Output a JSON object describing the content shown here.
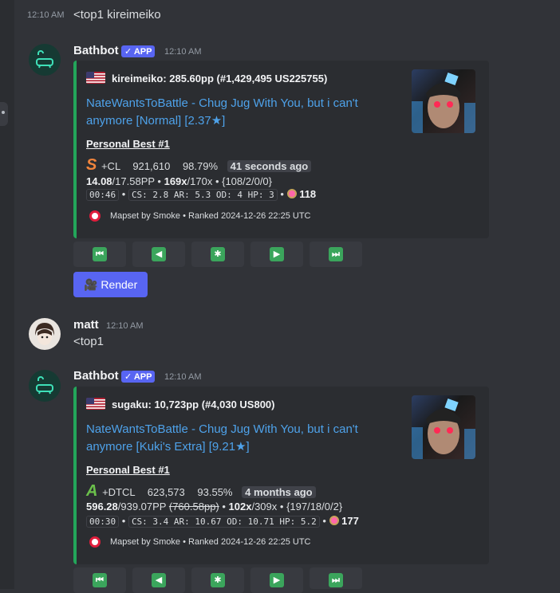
{
  "top_message": {
    "timestamp": "12:10 AM",
    "text": "<top1 kireimeiko"
  },
  "messages": [
    {
      "author": "Bathbot",
      "badge": "✓ APP",
      "timestamp": "12:10 AM",
      "embed": {
        "author_line": "kireimeiko: 285.60pp (#1,429,495 US225755)",
        "title_line1": "NateWantsToBattle - Chug Jug With You, but i can't",
        "title_line2": "anymore [Normal] [2.37★]",
        "pb": "Personal Best #1",
        "grade": "S",
        "grade_color": "#f0843c",
        "mods": "+CL",
        "score": "921,610",
        "acc": "98.79%",
        "ago": "41 seconds ago",
        "pp_bold": "14.08",
        "pp_rest": "/17.58PP",
        "pp_strike": "",
        "combo_bold": "169x",
        "combo_rest": "/170x",
        "hits": "{108/2/0/0}",
        "length": "00:46",
        "stats": "CS: 2.8 AR: 5.3 OD: 4 HP: 3",
        "bpm": "118",
        "footer": "Mapset by Smoke • Ranked 2024-12-26 22:25 UTC"
      }
    },
    {
      "author": "matt",
      "timestamp": "12:10 AM",
      "text": "<top1"
    },
    {
      "author": "Bathbot",
      "badge": "✓ APP",
      "timestamp": "12:10 AM",
      "embed": {
        "author_line": "sugaku: 10,723pp (#4,030 US800)",
        "title_line1": "NateWantsToBattle - Chug Jug With You, but i can't",
        "title_line2": "anymore [Kuki's Extra] [9.21★]",
        "pb": "Personal Best #1",
        "grade": "A",
        "grade_color": "#6bc04b",
        "mods": "+DTCL",
        "score": "623,573",
        "acc": "93.55%",
        "ago": "4 months ago",
        "pp_bold": "596.28",
        "pp_rest": "/939.07PP",
        "pp_strike": "(760.58pp)",
        "combo_bold": "102x",
        "combo_rest": "/309x",
        "hits": "{197/18/0/2}",
        "length": "00:30",
        "stats": "CS: 3.4 AR: 10.67 OD: 10.71 HP: 5.2",
        "bpm": "177",
        "footer": "Mapset by Smoke • Ranked 2024-12-26 22:25 UTC"
      }
    }
  ],
  "nav_buttons": [
    "⏮",
    "◀",
    "✱",
    "▶",
    "⏭"
  ],
  "render_button": {
    "icon": "🎥",
    "label": "Render"
  },
  "colors": {
    "background": "#313338",
    "embed_bg": "#2b2d31",
    "embed_border": "#23a55a",
    "link": "#4ea2ea",
    "blurple": "#5865f2"
  }
}
